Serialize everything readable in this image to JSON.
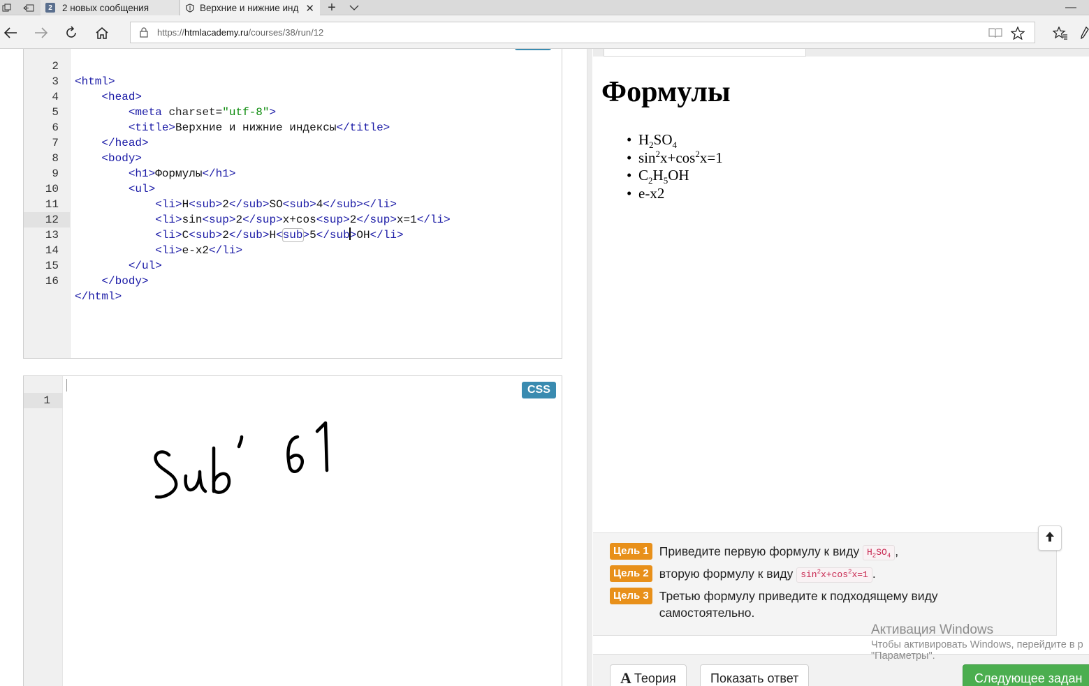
{
  "browser": {
    "tabs": [
      {
        "badge": "2",
        "label": "2 новых сообщения",
        "active": false
      },
      {
        "label": "Верхние и нижние инд",
        "active": true
      }
    ],
    "new_tab_icon": "plus-icon",
    "tab_list_icon": "chevron-down-icon",
    "address": {
      "scheme": "https://",
      "domain": "htmlacademy.ru",
      "path": "/courses/38/run/12"
    }
  },
  "html_editor": {
    "lines": [
      {
        "num": "2"
      },
      {
        "num": "3"
      },
      {
        "num": "4"
      },
      {
        "num": "5"
      },
      {
        "num": "6"
      },
      {
        "num": "7"
      },
      {
        "num": "8"
      },
      {
        "num": "9"
      },
      {
        "num": "10"
      },
      {
        "num": "11"
      },
      {
        "num": "12"
      },
      {
        "num": "13"
      },
      {
        "num": "14"
      },
      {
        "num": "15"
      },
      {
        "num": "16"
      }
    ],
    "active_line": "12"
  },
  "css_editor": {
    "line_number": "1",
    "badge": "CSS",
    "handwriting": "Sub 61"
  },
  "preview": {
    "heading": "Формулы",
    "items": [
      "H2SO4",
      "sin2x+cos2x=1",
      "C2H5OH",
      "e-x2"
    ]
  },
  "tasks": [
    {
      "badge": "Цель 1",
      "text": "Приведите первую формулу к виду",
      "formula": "H2SO4",
      "suffix": ","
    },
    {
      "badge": "Цель 2",
      "text": "вторую формулу к виду",
      "formula": "sin2x+cos2x=1",
      "suffix": "."
    },
    {
      "badge": "Цель 3",
      "text_line1": "Третью формулу приведите к подходящему виду",
      "text_line2": "самостоятельно."
    }
  ],
  "buttons": {
    "theory": "Теория",
    "show_answer": "Показать ответ",
    "next_task": "Следующее задан"
  },
  "watermark": {
    "title": "Активация Windows",
    "line1": "Чтобы активировать Windows, перейдите в р",
    "line2": "\"Параметры\"."
  },
  "colors": {
    "goal_badge": "#e8901a",
    "css_badge": "#3a8bb0",
    "primary_button": "#4bae4f",
    "tag_color": "#1a1aa6",
    "string_color": "#0a8a0a"
  }
}
